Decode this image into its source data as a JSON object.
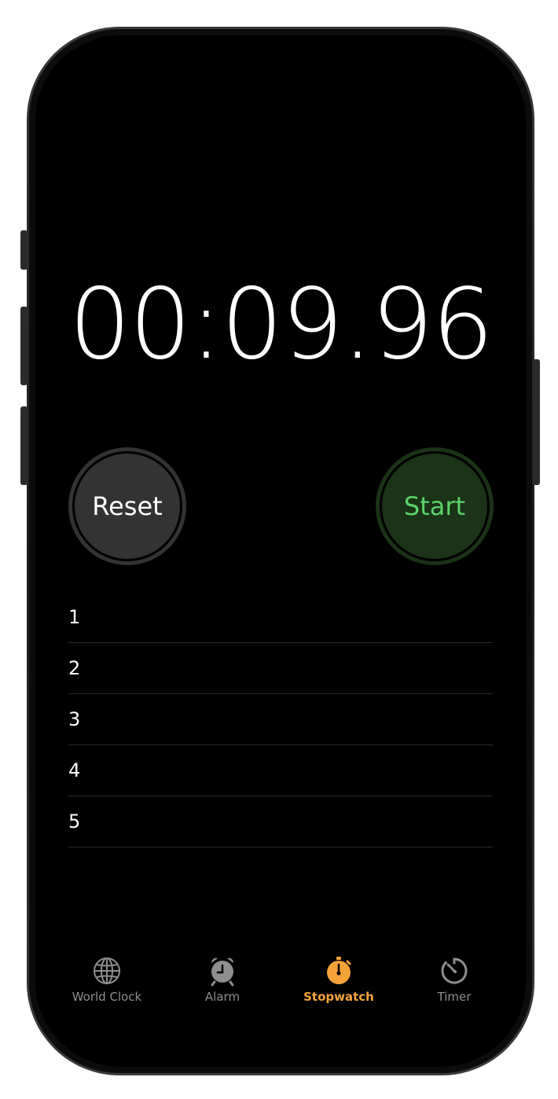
{
  "stopwatch": {
    "time": "00:09.96"
  },
  "controls": {
    "reset_label": "Reset",
    "start_label": "Start"
  },
  "laps": [
    "1",
    "2",
    "3",
    "4",
    "5"
  ],
  "tabbar": {
    "items": [
      {
        "label": "World Clock",
        "icon": "globe-icon",
        "active": false
      },
      {
        "label": "Alarm",
        "icon": "alarm-clock-icon",
        "active": false
      },
      {
        "label": "Stopwatch",
        "icon": "stopwatch-icon",
        "active": true
      },
      {
        "label": "Timer",
        "icon": "timer-icon",
        "active": false
      }
    ]
  },
  "colors": {
    "accent": "#f4a33a",
    "start_text": "#5cd36a",
    "start_bg": "#1b3317",
    "reset_bg": "#333333",
    "inactive_tab": "#8e8e8e"
  }
}
